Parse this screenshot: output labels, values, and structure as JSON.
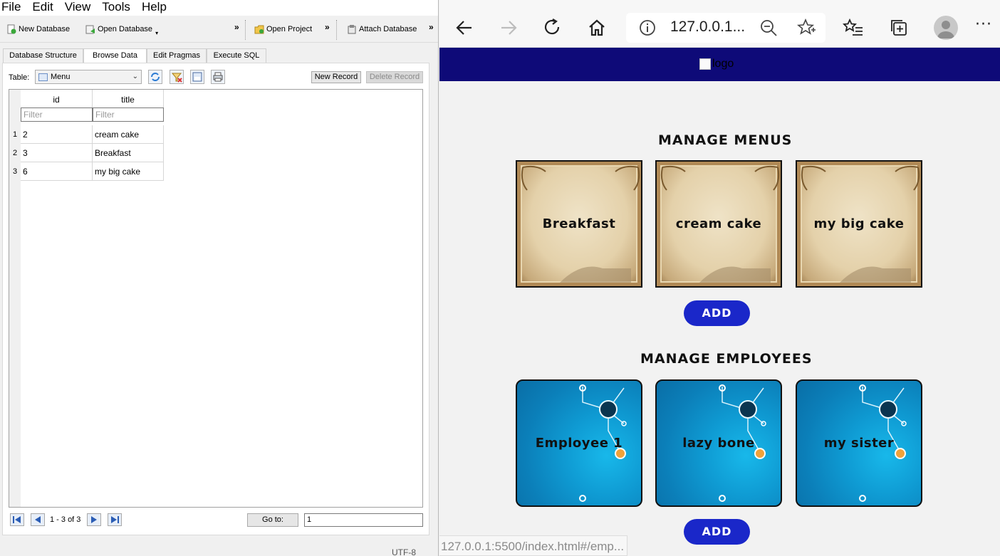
{
  "db_browser": {
    "menubar": [
      "File",
      "Edit",
      "View",
      "Tools",
      "Help"
    ],
    "toolbar": {
      "new_database": "New Database",
      "open_database": "Open Database",
      "open_project": "Open Project",
      "attach_database": "Attach Database",
      "more": "»"
    },
    "tabs": [
      "Database Structure",
      "Browse Data",
      "Edit Pragmas",
      "Execute SQL"
    ],
    "active_tab": "Browse Data",
    "table_label": "Table:",
    "selected_table": "Menu",
    "new_record": "New Record",
    "delete_record": "Delete Record",
    "columns": [
      "id",
      "title"
    ],
    "filter_placeholder": "Filter",
    "rows": [
      {
        "n": "1",
        "id": "2",
        "title": "cream cake"
      },
      {
        "n": "2",
        "id": "3",
        "title": "Breakfast"
      },
      {
        "n": "3",
        "id": "6",
        "title": "my big cake"
      }
    ],
    "record_count": "1 - 3 of 3",
    "goto_label": "Go to:",
    "goto_value": "1",
    "encoding": "UTF-8"
  },
  "browser": {
    "url": "127.0.0.1...",
    "status_url": "127.0.0.1:5500/index.html#/emp...",
    "logo_alt": "logo",
    "accent_color": "#1a27c9",
    "header_color": "#0e0a78"
  },
  "page": {
    "menus_title": "MANAGE MENUS",
    "menus": [
      "Breakfast",
      "cream cake",
      "my big cake"
    ],
    "employees_title": "MANAGE EMPLOYEES",
    "employees": [
      "Employee 1",
      "lazy bone",
      "my sister"
    ],
    "add_label": "ADD"
  }
}
